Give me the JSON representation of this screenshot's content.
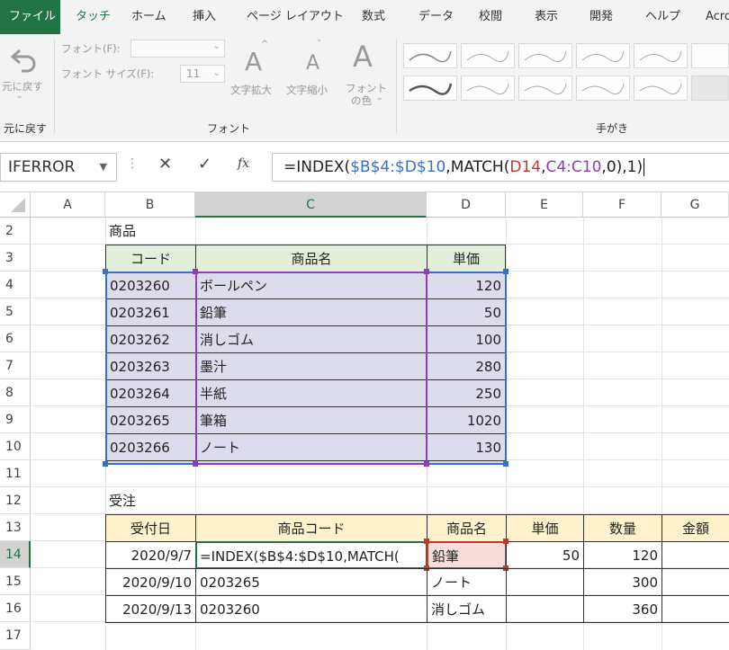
{
  "ribbon_tabs": [
    "ファイル",
    "タッチ",
    "ホーム",
    "挿入",
    "ページ レイアウト",
    "数式",
    "データ",
    "校閲",
    "表示",
    "開発",
    "ヘルプ",
    "Acro"
  ],
  "ribbon": {
    "undo_label": "元に戻す",
    "undo_group": "元に戻す",
    "font_label": "フォント(F):",
    "font_size_label": "フォント サイズ(F):",
    "font_size_value": "11",
    "grow_label": "文字拡大",
    "shrink_label": "文字縮小",
    "font_color_label_1": "フォント",
    "font_color_label_2": "の色",
    "font_group": "フォント",
    "ink_group": "手がき"
  },
  "formula_bar": {
    "name_box": "IFERROR",
    "fx": "fx",
    "f_part1": "=INDEX(",
    "f_ref1": "$B$4:$D$10",
    "f_part2": ",MATCH(",
    "f_ref2": "D14",
    "f_part3": ",",
    "f_ref3": "C4:C10",
    "f_part4": ",0),1)"
  },
  "columns": [
    "A",
    "B",
    "C",
    "D",
    "E",
    "F",
    "G"
  ],
  "rows": [
    "2",
    "3",
    "4",
    "5",
    "6",
    "7",
    "8",
    "9",
    "10",
    "11",
    "12",
    "13",
    "14",
    "15",
    "16",
    "17"
  ],
  "products": {
    "section_label": "商品",
    "headers": [
      "コード",
      "商品名",
      "単価"
    ],
    "items": [
      {
        "code": "0203260",
        "name": "ボールペン",
        "price": "120"
      },
      {
        "code": "0203261",
        "name": "鉛筆",
        "price": "50"
      },
      {
        "code": "0203262",
        "name": "消しゴム",
        "price": "100"
      },
      {
        "code": "0203263",
        "name": "墨汁",
        "price": "280"
      },
      {
        "code": "0203264",
        "name": "半紙",
        "price": "250"
      },
      {
        "code": "0203265",
        "name": "筆箱",
        "price": "1020"
      },
      {
        "code": "0203266",
        "name": "ノート",
        "price": "130"
      }
    ]
  },
  "orders": {
    "section_label": "受注",
    "headers": [
      "受付日",
      "商品コード",
      "商品名",
      "単価",
      "数量",
      "金額"
    ],
    "rows": [
      {
        "date": "2020/9/7",
        "code": "=INDEX($B$4:$D$10,MATCH(",
        "name": "鉛筆",
        "price": "50",
        "qty": "120"
      },
      {
        "date": "2020/9/10",
        "code": "0203265",
        "name": "ノート",
        "price": "",
        "qty": "300"
      },
      {
        "date": "2020/9/13",
        "code": "0203260",
        "name": "消しゴム",
        "price": "",
        "qty": "360"
      }
    ]
  },
  "colors": {
    "excel_green": "#217346",
    "header_green": "#e2efda",
    "header_yellow": "#fff2cc",
    "range_purple": "#8b3fb8",
    "range_blue": "#3b6fc4",
    "range_red": "#c0392b"
  }
}
